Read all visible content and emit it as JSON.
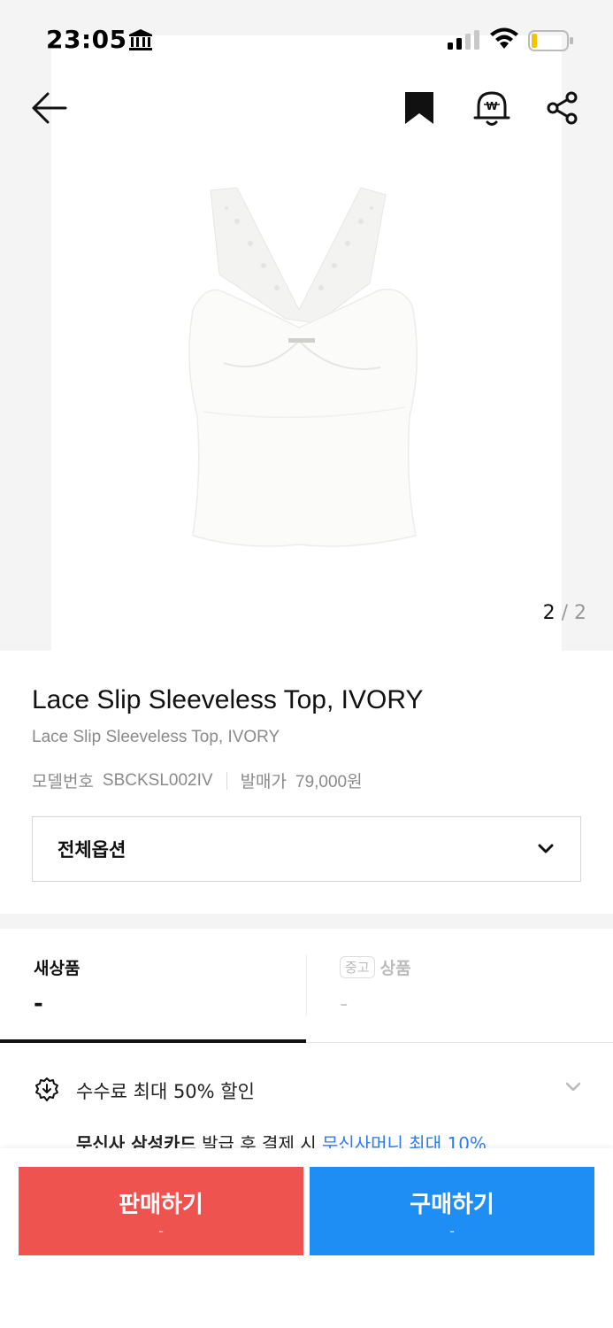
{
  "status_bar": {
    "time": "23:05"
  },
  "gallery": {
    "current_page": "2",
    "separator": "/",
    "total_pages": "2"
  },
  "product": {
    "title": "Lace Slip Sleeveless Top, IVORY",
    "subtitle": "Lace Slip Sleeveless Top, IVORY",
    "model_label": "모델번호",
    "model_number": "SBCKSL002IV",
    "release_price_label": "발매가",
    "release_price": "79,000원"
  },
  "options": {
    "selected": "전체옵션"
  },
  "tabs": [
    {
      "label": "새상품",
      "value": "-",
      "active": true
    },
    {
      "badge": "중고",
      "label": "상품",
      "value": "-",
      "active": false
    }
  ],
  "benefit": {
    "text": "수수료 최대 50% 할인",
    "promo_bold": "무신사 삼성카드",
    "promo_text": " 발급 후 결제 시 ",
    "promo_link": "무신사머니 최대 10%"
  },
  "actions": {
    "sell_label": "판매하기",
    "sell_sub": "-",
    "buy_label": "구매하기",
    "buy_sub": "-"
  },
  "colors": {
    "sell": "#ef5350",
    "buy": "#1e8ef5",
    "link": "#2e7cf6"
  },
  "icons": [
    "back-arrow-icon",
    "bookmark-icon",
    "price-alert-icon",
    "share-icon",
    "discount-icon",
    "chevron-down-icon"
  ]
}
